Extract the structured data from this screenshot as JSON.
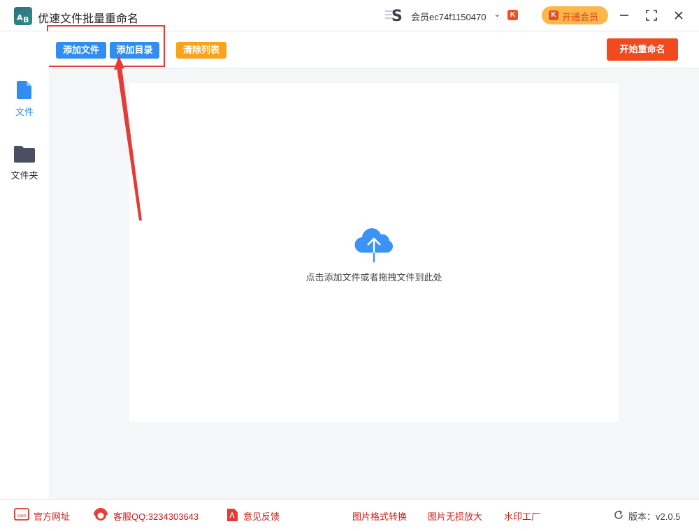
{
  "app": {
    "title": "优速文件批量重命名",
    "logo_letters": [
      "A",
      "B"
    ],
    "user_name": "会员ec74f1150470",
    "vip_badge": "K",
    "vip_button": "开通会员",
    "window_controls": [
      "minimize-icon",
      "maximize-icon",
      "close-icon"
    ]
  },
  "toolbar": {
    "add_file": "添加文件",
    "add_dir": "添加目录",
    "clear_list": "清除列表",
    "start_rename": "开始重命名"
  },
  "sidebar": {
    "items": [
      {
        "label": "文件",
        "icon": "file-icon",
        "active": true
      },
      {
        "label": "文件夹",
        "icon": "folder-icon",
        "active": false
      }
    ]
  },
  "content": {
    "drop_hint": "点击添加文件或者拖拽文件到此处",
    "icon": "cloud-upload-icon"
  },
  "footer": {
    "website": "官方网址",
    "qq": "客服QQ:3234303643",
    "feedback": "意见反馈",
    "img_convert": "图片格式转换",
    "img_enlarge": "图片无损放大",
    "watermark": "水印工厂",
    "version": "版本：v2.0.5"
  },
  "colors": {
    "blue_button": "#2f8ef0",
    "orange_button": "#fca21a",
    "start_button": "#f04b1f",
    "highlight": "#e33b36",
    "cloud": "#3a93f5"
  }
}
